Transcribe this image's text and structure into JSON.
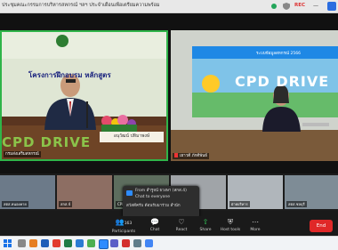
{
  "window": {
    "title": "ประชุมคณะกรรมการบริหารสหกรณ์ ฯลฯ ประจำเดือนเพื่อเตรียมความพร้อม",
    "rec_label": "REC"
  },
  "speakers": [
    {
      "name": "กรมส่งเสริมสหกรณ์",
      "banner_title": "โครงการฝึกอบรม หลักสูตร",
      "banner_brand": "CPD DRIVE",
      "desk_sign": "อนุวัฒน์ ปทิมาพงษ์"
    },
    {
      "name": "เยาวดี ภักดีพันธ์",
      "banner_brand": "CPD DRIVE",
      "banner_sub": "ระบบข้อมูลสหกรณ์ 2566"
    }
  ],
  "participants": [
    {
      "name": "สตส.หนองคาย"
    },
    {
      "name": "สกส.4"
    },
    {
      "name": "CPD Drive สำนักงาน"
    },
    {
      "name": "สหกรณ์จังหวัด"
    },
    {
      "name": "ฝ่ายบริหาร"
    },
    {
      "name": "สตส.ชลบุรี"
    }
  ],
  "chat": {
    "header": "From สำรูจน์ ธวงษา (สกส.4)",
    "to": "Chat to everyone",
    "message": "สวัสดีครับ ต้อนรับมาร่วม สำนัก"
  },
  "controls": [
    {
      "label": "Participants",
      "glyph": "👥",
      "badge": "163"
    },
    {
      "label": "Chat",
      "glyph": "💬"
    },
    {
      "label": "React",
      "glyph": "♡"
    },
    {
      "label": "Share",
      "glyph": "⇧"
    },
    {
      "label": "Host tools",
      "glyph": "⛨"
    },
    {
      "label": "More",
      "glyph": "⋯"
    }
  ],
  "end_label": "End",
  "colors": {
    "active_speaker_border": "#2fb449",
    "end_button": "#e02828",
    "accent": "#2d8cff"
  }
}
